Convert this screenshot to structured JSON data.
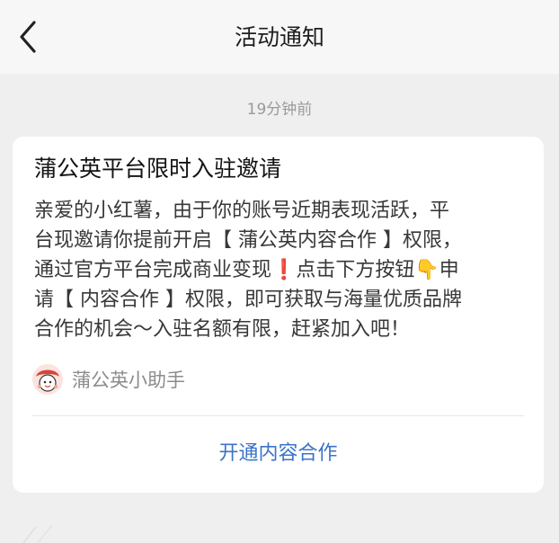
{
  "header": {
    "title": "活动通知",
    "back_icon": "chevron-left-icon"
  },
  "message": {
    "timestamp": "19分钟前",
    "title": "蒲公英平台限时入驻邀请",
    "body": "亲爱的小红薯，由于你的账号近期表现活跃，平\n台现邀请你提前开启【 蒲公英内容合作 】权限，\n通过官方平台完成商业变现❗点击下方按钮👇申\n请【 内容合作 】权限，即可获取与海量优质品牌\n合作的机会～入驻名额有限，赶紧加入吧！",
    "sender": {
      "name": "蒲公英小助手",
      "avatar_icon": "avatar-icon"
    },
    "action_label": "开通内容合作"
  },
  "colors": {
    "background": "#efefef",
    "header_bg": "#f7f7f7",
    "card_bg": "#ffffff",
    "link_blue": "#3b74c8",
    "timestamp_gray": "#9a9a9a"
  }
}
